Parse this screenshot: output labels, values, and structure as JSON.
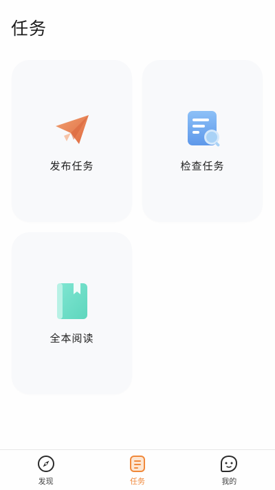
{
  "header": {
    "title": "任务"
  },
  "cards": [
    {
      "label": "发布任务",
      "icon": "paper-plane-icon"
    },
    {
      "label": "检查任务",
      "icon": "document-search-icon"
    },
    {
      "label": "全本阅读",
      "icon": "book-icon"
    }
  ],
  "tabbar": {
    "tabs": [
      {
        "label": "发现",
        "icon": "compass-icon",
        "active": false
      },
      {
        "label": "任务",
        "icon": "task-list-icon",
        "active": true
      },
      {
        "label": "我的",
        "icon": "face-icon",
        "active": false
      }
    ]
  },
  "colors": {
    "accent": "#f0883a",
    "card_background": "#f8f9fb",
    "plane": "#e8845a",
    "doc": "#6ea8f0",
    "book": "#6fdcc8"
  }
}
